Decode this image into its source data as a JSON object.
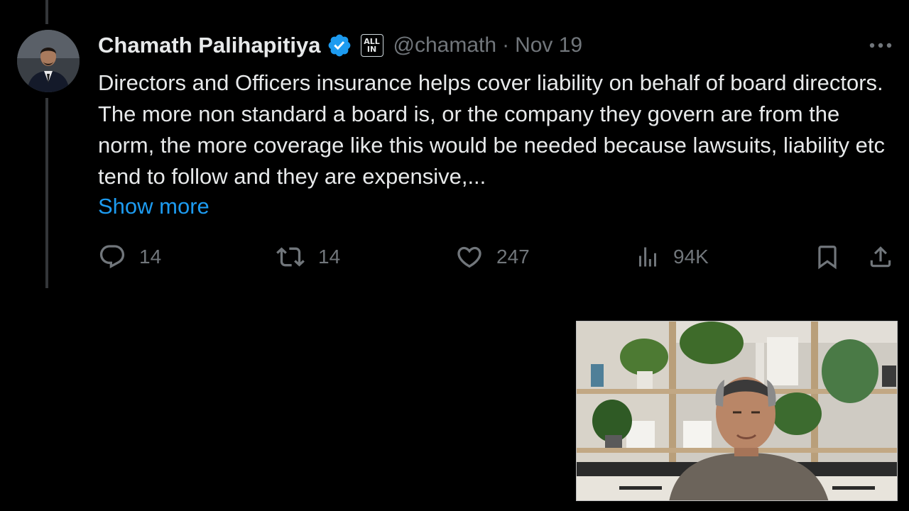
{
  "tweet": {
    "author_name": "Chamath Palihapitiya",
    "affiliate_badge": "ALL IN",
    "affiliate_top": "ALL",
    "affiliate_bottom": "IN",
    "handle": "@chamath",
    "separator": "·",
    "date": "Nov 19",
    "body": "Directors and Officers insurance helps cover liability on behalf of board directors. The more non standard a board is, or the company they govern are from the norm, the more coverage like this would be needed because lawsuits, liability etc tend to follow and they are expensive,...",
    "show_more_label": "Show more"
  },
  "actions": {
    "replies": "14",
    "reposts": "14",
    "likes": "247",
    "views": "94K"
  },
  "icons": {
    "verified": "verified-badge-icon",
    "more": "more-horizontal-icon",
    "reply": "reply-icon",
    "repost": "repost-icon",
    "like": "heart-icon",
    "views": "analytics-bars-icon",
    "bookmark": "bookmark-icon",
    "share": "share-icon"
  },
  "colors": {
    "background": "#000000",
    "text": "#e7e9ea",
    "secondary_text": "#71767b",
    "link": "#1d9bf0",
    "verified": "#1d9bf0"
  }
}
